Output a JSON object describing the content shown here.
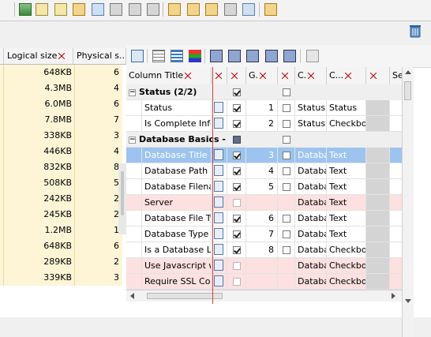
{
  "left_table": {
    "headers": [
      "Logical size",
      "Physical s..."
    ],
    "rows": [
      {
        "logical": "648KB",
        "physical": "6"
      },
      {
        "logical": "4.3MB",
        "physical": "4"
      },
      {
        "logical": "6.0MB",
        "physical": "6"
      },
      {
        "logical": "7.8MB",
        "physical": "7"
      },
      {
        "logical": "338KB",
        "physical": "3"
      },
      {
        "logical": "446KB",
        "physical": "4"
      },
      {
        "logical": "832KB",
        "physical": "8"
      },
      {
        "logical": "508KB",
        "physical": "5"
      },
      {
        "logical": "242KB",
        "physical": "2"
      },
      {
        "logical": "245KB",
        "physical": "2"
      },
      {
        "logical": "1.2MB",
        "physical": "1"
      },
      {
        "logical": "648KB",
        "physical": "6"
      },
      {
        "logical": "289KB",
        "physical": "2"
      },
      {
        "logical": "339KB",
        "physical": "3"
      }
    ]
  },
  "grid": {
    "headers": [
      "Column Title",
      "G.",
      "C.",
      "C...",
      "Se"
    ],
    "groups": [
      {
        "title": "Status (2/2)",
        "rows": [
          {
            "title": "Status",
            "num": "1",
            "c1": "Status",
            "c2": "Status",
            "visible": true,
            "cb": false
          },
          {
            "title": "Is Complete Info",
            "num": "2",
            "c1": "Status",
            "c2": "Checkbo",
            "visible": true,
            "cb": false
          }
        ]
      },
      {
        "title": "Database Basics - ...",
        "rows": [
          {
            "title": "Database Title",
            "num": "3",
            "c1": "Databa",
            "c2": "Text",
            "visible": true,
            "selected": true
          },
          {
            "title": "Database Path",
            "num": "4",
            "c1": "Databa",
            "c2": "Text",
            "visible": true
          },
          {
            "title": "Database Filenar",
            "num": "5",
            "c1": "Databa",
            "c2": "Text",
            "visible": true
          },
          {
            "title": "Server",
            "num": "",
            "c1": "Databa",
            "c2": "Text",
            "visible": false,
            "pink": true
          },
          {
            "title": "Database File Ty",
            "num": "6",
            "c1": "Databa",
            "c2": "Text",
            "visible": true
          },
          {
            "title": "Database Type",
            "num": "7",
            "c1": "Databa",
            "c2": "Text",
            "visible": true
          },
          {
            "title": "Is a Database Lir",
            "num": "8",
            "c1": "Databa",
            "c2": "Checkbo",
            "visible": true
          },
          {
            "title": "Use Javascript w",
            "num": "",
            "c1": "Databa",
            "c2": "Checkbo",
            "visible": false,
            "pink": true
          },
          {
            "title": "Require SSL Con",
            "num": "",
            "c1": "Databa",
            "c2": "Checkbo",
            "visible": false,
            "pink": true
          }
        ]
      }
    ]
  },
  "colors": {
    "left_row_bg": "#fdf5d6",
    "selected_row": "#9cc4ee",
    "hidden_row": "#fde0e0",
    "divider_line": "#d04040"
  }
}
